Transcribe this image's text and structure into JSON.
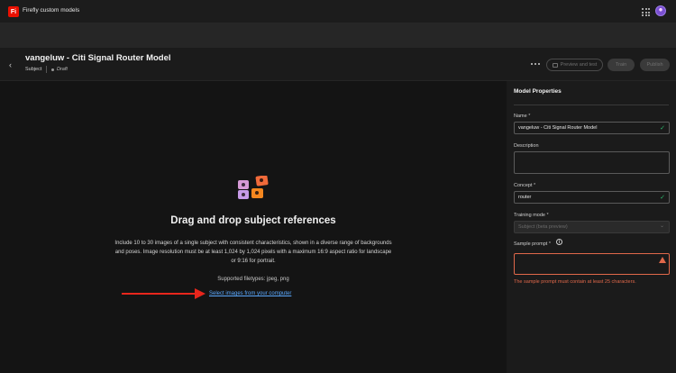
{
  "app": {
    "logo_text": "Fi",
    "title": "Firefly custom models"
  },
  "header": {
    "model_title": "vangeluw - Citi Signal Router Model",
    "subject_label": "Subject",
    "status": "Draft",
    "buttons": {
      "preview": "Preview and test",
      "train": "Train",
      "publish": "Publish"
    }
  },
  "upload": {
    "title": "Drag and drop subject references",
    "description": "Include 10 to 30 images of a single subject with consistent characteristics, shown in a diverse range of backgrounds and poses. Image resolution must be at least 1,024 by 1,024 pixels with a maximum 16:9 aspect ratio for landscape or 9:16 for portrait.",
    "filetypes": "Supported filetypes: jpeg, png",
    "select_link": "Select images from your computer"
  },
  "panel": {
    "title": "Model Properties",
    "name": {
      "label": "Name",
      "required": "*",
      "value": "vangeluw - Citi Signal Router Model"
    },
    "description": {
      "label": "Description",
      "value": ""
    },
    "concept": {
      "label": "Concept",
      "required": "*",
      "value": "router"
    },
    "training_mode": {
      "label": "Training mode",
      "required": "*",
      "value": "Subject (beta preview)"
    },
    "sample_prompt": {
      "label": "Sample prompt",
      "required": "*",
      "value": "",
      "error": "The sample prompt must contain at least 25 characters."
    }
  },
  "colors": {
    "accent_link": "#5aa9ff",
    "success": "#2dba6e",
    "error": "#e0684a",
    "arrow": "#e8261c",
    "brand": "#eb1000"
  }
}
